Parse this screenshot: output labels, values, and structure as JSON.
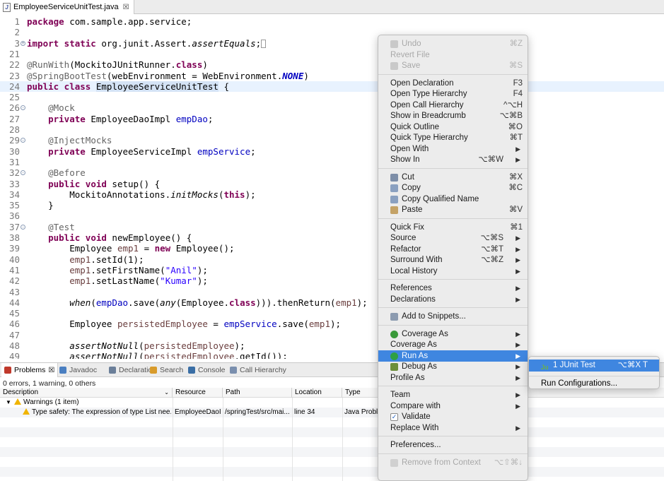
{
  "editor_tab": {
    "title": "EmployeeServiceUnitTest.java",
    "close": "☒"
  },
  "code_lines": [
    {
      "n": "1",
      "html": "<span class='kw'>package</span> com.sample.app.service;"
    },
    {
      "n": "2",
      "html": ""
    },
    {
      "n": "3",
      "html": "<span class='kw'>import static</span> org.junit.Assert.<span class='itl'>assertEquals</span>;<span class='cursorbox'></span>",
      "fold": "+"
    },
    {
      "n": "21",
      "html": ""
    },
    {
      "n": "22",
      "html": "<span class='ann'>@RunWith</span>(MockitoJUnitRunner.<span class='kw'>class</span>)"
    },
    {
      "n": "23",
      "html": "<span class='ann'>@SpringBootTest</span>(webEnvironment = WebEnvironment.<span class='cst'>NONE</span>)"
    },
    {
      "n": "24",
      "html": "<span class='kw'>public class</span> <span class='sel'>EmployeeServiceUnitTest</span> {",
      "current": true
    },
    {
      "n": "25",
      "html": ""
    },
    {
      "n": "26",
      "html": "    <span class='ann'>@Mock</span>",
      "fold": "-"
    },
    {
      "n": "27",
      "html": "    <span class='kw'>private</span> EmployeeDaoImpl <span class='fld'>empDao</span>;"
    },
    {
      "n": "28",
      "html": ""
    },
    {
      "n": "29",
      "html": "    <span class='ann'>@InjectMocks</span>",
      "fold": "-"
    },
    {
      "n": "30",
      "html": "    <span class='kw'>private</span> EmployeeServiceImpl <span class='fld'>empService</span>;"
    },
    {
      "n": "31",
      "html": ""
    },
    {
      "n": "32",
      "html": "    <span class='ann'>@Before</span>",
      "fold": "-"
    },
    {
      "n": "33",
      "html": "    <span class='kw'>public void</span> setup() {"
    },
    {
      "n": "34",
      "html": "        MockitoAnnotations.<span class='itl'>initMocks</span>(<span class='kw'>this</span>);"
    },
    {
      "n": "35",
      "html": "    }"
    },
    {
      "n": "36",
      "html": ""
    },
    {
      "n": "37",
      "html": "    <span class='ann'>@Test</span>",
      "fold": "-"
    },
    {
      "n": "38",
      "html": "    <span class='kw'>public void</span> newEmployee() {"
    },
    {
      "n": "39",
      "html": "        Employee <span class='loc'>emp1</span> = <span class='kw'>new</span> Employee();"
    },
    {
      "n": "40",
      "html": "        <span class='loc'>emp1</span>.setId(1);"
    },
    {
      "n": "41",
      "html": "        <span class='loc'>emp1</span>.setFirstName(<span class='str'>\"Anil\"</span>);"
    },
    {
      "n": "42",
      "html": "        <span class='loc'>emp1</span>.setLastName(<span class='str'>\"Kumar\"</span>);"
    },
    {
      "n": "43",
      "html": ""
    },
    {
      "n": "44",
      "html": "        <span class='itl'>when</span>(<span class='fld'>empDao</span>.save(<span class='itl'>any</span>(Employee.<span class='kw'>class</span>))).thenReturn(<span class='loc'>emp1</span>);"
    },
    {
      "n": "45",
      "html": ""
    },
    {
      "n": "46",
      "html": "        Employee <span class='loc'>persistedEmployee</span> = <span class='fld'>empService</span>.save(<span class='loc'>emp1</span>);"
    },
    {
      "n": "47",
      "html": ""
    },
    {
      "n": "48",
      "html": "        <span class='itl'>assertNotNull</span>(<span class='loc'>persistedEmployee</span>);"
    },
    {
      "n": "49",
      "html": "        <span class='itl'>assertNotNull</span>(<span class='loc'>persistedEmployee</span>.getId());"
    }
  ],
  "view_tabs": [
    {
      "label": "Problems",
      "icon": "problems-icon",
      "color": "#c0392b",
      "active": true
    },
    {
      "label": "Javadoc",
      "icon": "javadoc-icon",
      "color": "#4a7fc1"
    },
    {
      "label": "Declaration",
      "icon": "declaration-icon",
      "color": "#6b7f99"
    },
    {
      "label": "Search",
      "icon": "search-icon",
      "color": "#d89b2b"
    },
    {
      "label": "Console",
      "icon": "console-icon",
      "color": "#3a6ea5"
    },
    {
      "label": "Call Hierarchy",
      "icon": "call-hierarchy-icon",
      "color": "#7a8fae"
    }
  ],
  "problems": {
    "summary": "0 errors, 1 warning, 0 others",
    "columns": [
      "Description",
      "Resource",
      "Path",
      "Location",
      "Type"
    ],
    "group": "Warnings (1 item)",
    "row": {
      "description": "Type safety: The expression of type List nee...",
      "resource": "EmployeeDaoI...",
      "path": "/springTest/src/mai...",
      "location": "line 34",
      "type": "Java Proble"
    }
  },
  "context_menu": [
    {
      "label": "Undo",
      "shortcut": "⌘Z",
      "disabled": true,
      "icon": "undo-icon"
    },
    {
      "label": "Revert File",
      "disabled": true
    },
    {
      "label": "Save",
      "shortcut": "⌘S",
      "disabled": true,
      "icon": "save-icon"
    },
    {
      "sep": true
    },
    {
      "label": "Open Declaration",
      "shortcut": "F3"
    },
    {
      "label": "Open Type Hierarchy",
      "shortcut": "F4"
    },
    {
      "label": "Open Call Hierarchy",
      "shortcut": "^⌥H"
    },
    {
      "label": "Show in Breadcrumb",
      "shortcut": "⌥⌘B"
    },
    {
      "label": "Quick Outline",
      "shortcut": "⌘O"
    },
    {
      "label": "Quick Type Hierarchy",
      "shortcut": "⌘T"
    },
    {
      "label": "Open With",
      "submenu": true
    },
    {
      "label": "Show In",
      "shortcut": "⌥⌘W",
      "submenu": true
    },
    {
      "sep": true
    },
    {
      "label": "Cut",
      "shortcut": "⌘X",
      "icon": "cut-icon"
    },
    {
      "label": "Copy",
      "shortcut": "⌘C",
      "icon": "copy-icon"
    },
    {
      "label": "Copy Qualified Name",
      "icon": "copy-qualified-name-icon"
    },
    {
      "label": "Paste",
      "shortcut": "⌘V",
      "icon": "paste-icon"
    },
    {
      "sep": true
    },
    {
      "label": "Quick Fix",
      "shortcut": "⌘1"
    },
    {
      "label": "Source",
      "shortcut": "⌥⌘S",
      "submenu": true
    },
    {
      "label": "Refactor",
      "shortcut": "⌥⌘T",
      "submenu": true
    },
    {
      "label": "Surround With",
      "shortcut": "⌥⌘Z",
      "submenu": true
    },
    {
      "label": "Local History",
      "submenu": true
    },
    {
      "sep": true
    },
    {
      "label": "References",
      "submenu": true
    },
    {
      "label": "Declarations",
      "submenu": true
    },
    {
      "sep": true
    },
    {
      "label": "Add to Snippets...",
      "icon": "snippets-icon"
    },
    {
      "sep": true
    },
    {
      "label": "Coverage As",
      "submenu": true,
      "icon": "coverage-icon"
    },
    {
      "label": "Coverage As",
      "submenu": true
    },
    {
      "label": "Run As",
      "submenu": true,
      "icon": "run-icon",
      "highlight": true
    },
    {
      "label": "Debug As",
      "submenu": true,
      "icon": "debug-icon"
    },
    {
      "label": "Profile As",
      "submenu": true
    },
    {
      "sep": true
    },
    {
      "label": "Team",
      "submenu": true
    },
    {
      "label": "Compare with",
      "submenu": true
    },
    {
      "label": "Validate",
      "icon": "checkbox-checked-icon"
    },
    {
      "label": "Replace With",
      "submenu": true
    },
    {
      "sep": true
    },
    {
      "label": "Preferences..."
    },
    {
      "sep": true
    },
    {
      "label": "Remove from Context",
      "shortcut": "⌥⇧⌘↓",
      "disabled": true,
      "icon": "remove-context-icon"
    }
  ],
  "submenu": [
    {
      "label": "1 JUnit Test",
      "shortcut": "⌥⌘X T",
      "highlight": true,
      "icon": "junit-icon"
    },
    {
      "sep": true
    },
    {
      "label": "Run Configurations..."
    }
  ]
}
